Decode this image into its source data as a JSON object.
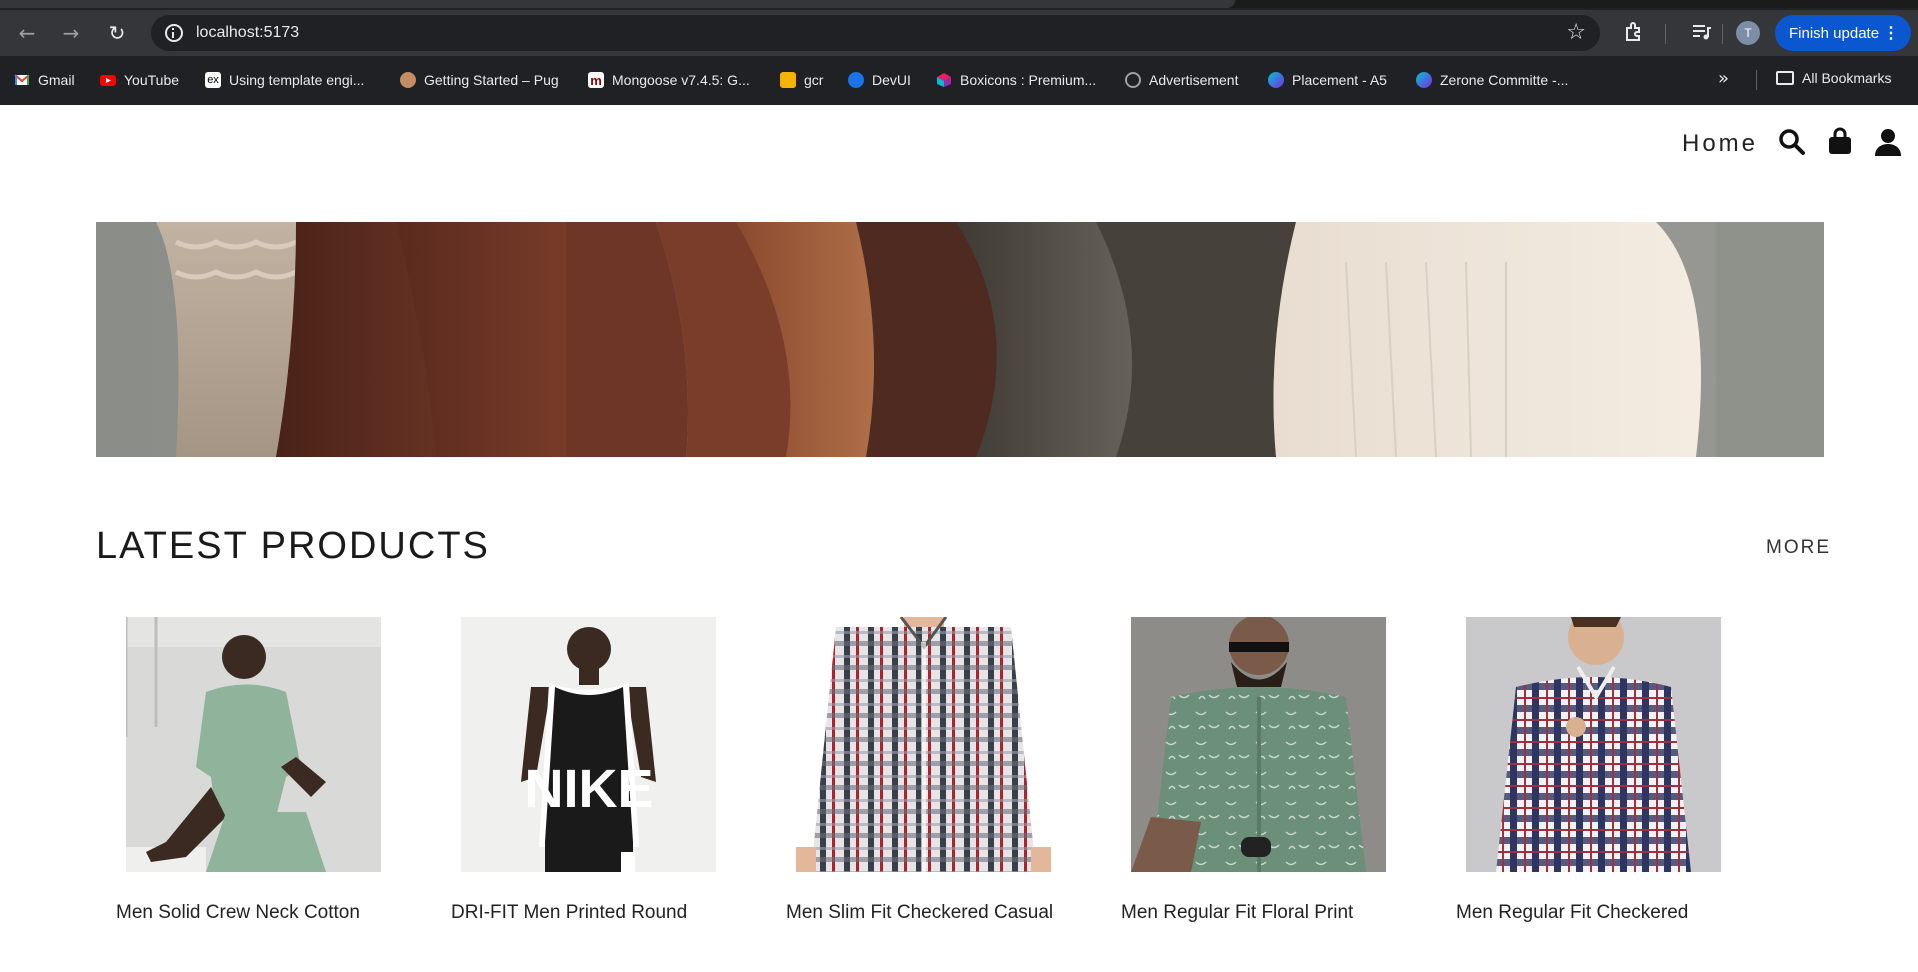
{
  "browser": {
    "url": "localhost:5173",
    "profile_initial": "T",
    "update_button": "Finish update",
    "all_bookmarks": "All Bookmarks",
    "bookmarks": [
      {
        "label": "Gmail",
        "icon": "gmail-icon",
        "color": "#ea4335"
      },
      {
        "label": "YouTube",
        "icon": "youtube-icon",
        "color": "#ff0000"
      },
      {
        "label": "Using template engi...",
        "icon": "express-icon",
        "color": "#ffffff"
      },
      {
        "label": "Getting Started – Pug",
        "icon": "pug-icon",
        "color": "#c58d63"
      },
      {
        "label": "Mongoose v7.4.5: G...",
        "icon": "mongoose-icon",
        "color": "#880000"
      },
      {
        "label": "gcr",
        "icon": "gcr-icon",
        "color": "#f4b400"
      },
      {
        "label": "DevUI",
        "icon": "devui-icon",
        "color": "#1a73e8"
      },
      {
        "label": "Boxicons : Premium...",
        "icon": "boxicons-icon",
        "color": "#e91e63"
      },
      {
        "label": "Advertisement",
        "icon": "globe-icon",
        "color": "#9aa0a6"
      },
      {
        "label": "Placement - A5",
        "icon": "canva-icon",
        "color": "#7d2ae8"
      },
      {
        "label": "Zerone Committe -...",
        "icon": "canva-icon",
        "color": "#7d2ae8"
      }
    ]
  },
  "nav": {
    "home": "Home",
    "icons": [
      "search-icon",
      "shopping-bag-icon",
      "user-icon"
    ]
  },
  "section": {
    "title": "LATEST PRODUCTS",
    "more": "MORE"
  },
  "products": [
    {
      "name": "Men Solid Crew Neck Cotton",
      "shirt_color": "#8fb39b",
      "bg": "#d9d9d7"
    },
    {
      "name": "DRI-FIT Men Printed Round",
      "shirt_color": "#1a1a1a",
      "bg": "#f0f0ee"
    },
    {
      "name": "Men Slim Fit Checkered Casual",
      "shirt_color": "#a9aeb5",
      "bg": "#ffffff"
    },
    {
      "name": "Men Regular Fit Floral Print",
      "shirt_color": "#6b8f78",
      "bg": "#8e8c88"
    },
    {
      "name": "Men Regular Fit Checkered",
      "shirt_color": "#3a3f66",
      "bg": "#c9c9cc"
    }
  ],
  "colors": {
    "accent": "#0b57d0",
    "chrome_bg": "#202124",
    "text": "#222222"
  }
}
